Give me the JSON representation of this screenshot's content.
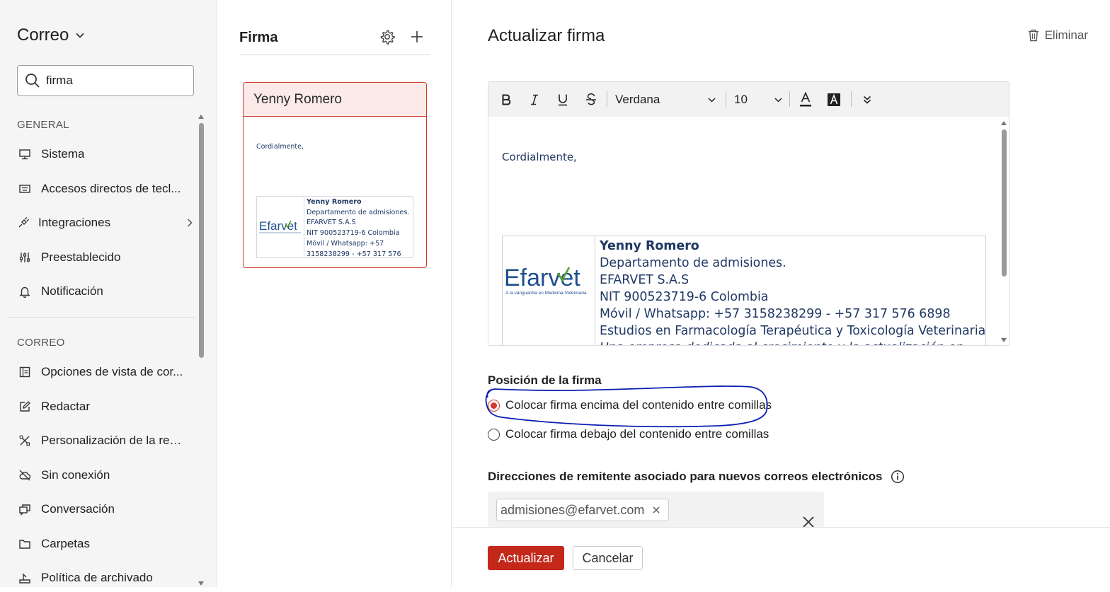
{
  "sidebar": {
    "app_title": "Correo",
    "search": {
      "value": "firma",
      "placeholder": ""
    },
    "general_header": "GENERAL",
    "general_items": [
      {
        "label": "Sistema",
        "icon": "monitor-icon"
      },
      {
        "label": "Accesos directos de tecl...",
        "icon": "keyboard-icon"
      },
      {
        "label": "Integraciones",
        "icon": "plug-icon"
      },
      {
        "label": "Preestablecido",
        "icon": "sliders-icon"
      },
      {
        "label": "Notificación",
        "icon": "bell-icon"
      }
    ],
    "correo_header": "CORREO",
    "correo_items": [
      {
        "label": "Opciones de vista de cor...",
        "icon": "layout-icon"
      },
      {
        "label": "Redactar",
        "icon": "compose-icon"
      },
      {
        "label": "Personalización de la red...",
        "icon": "tools-icon"
      },
      {
        "label": "Sin conexión",
        "icon": "cloud-off-icon"
      },
      {
        "label": "Conversación",
        "icon": "conversation-icon"
      },
      {
        "label": "Carpetas",
        "icon": "folder-icon"
      },
      {
        "label": "Política de archivado",
        "icon": "archive-policy-icon"
      }
    ]
  },
  "signatures": {
    "title": "Firma",
    "card": {
      "name": "Yenny Romero",
      "greeting": "Cordialmente,",
      "logo_text": "Efarvet",
      "lines": [
        "Yenny Romero",
        "Departamento de admisiones.",
        "EFARVET S.A.S",
        "NIT 900523719-6  Colombia",
        "Móvil / Whatsapp: +57",
        "3158238299 - +57 317 576"
      ]
    }
  },
  "editor_panel": {
    "title": "Actualizar firma",
    "delete_label": "Eliminar",
    "toolbar": {
      "font": "Verdana",
      "size": "10"
    },
    "content": {
      "greeting": "Cordialmente,",
      "logo_text": "Efarvet",
      "logo_tagline": "A la vanguardia en Medicina Veterinaria",
      "name": "Yenny Romero",
      "lines": [
        "Departamento de admisiones.",
        "EFARVET S.A.S",
        "NIT 900523719-6  Colombia",
        "Móvil / Whatsapp: +57 3158238299 - +57 317 576 6898",
        "Estudios en Farmacología Terapéutica y Toxicología Veterinaria",
        "Una empresa dedicada al crecimiento y la actualización en"
      ]
    },
    "position_label": "Posición de la firma",
    "position_options": [
      {
        "label": "Colocar firma encima del contenido entre comillas",
        "selected": true
      },
      {
        "label": "Colocar firma debajo del contenido entre comillas",
        "selected": false
      }
    ],
    "sender_label": "Direcciones de remitente asociado para nuevos correos electrónicos",
    "sender_chip": "admisiones@efarvet.com",
    "update_label": "Actualizar",
    "cancel_label": "Cancelar"
  },
  "colors": {
    "accent": "#c3281b",
    "signature_text": "#1f3864",
    "annotation": "#0a1fb0"
  }
}
